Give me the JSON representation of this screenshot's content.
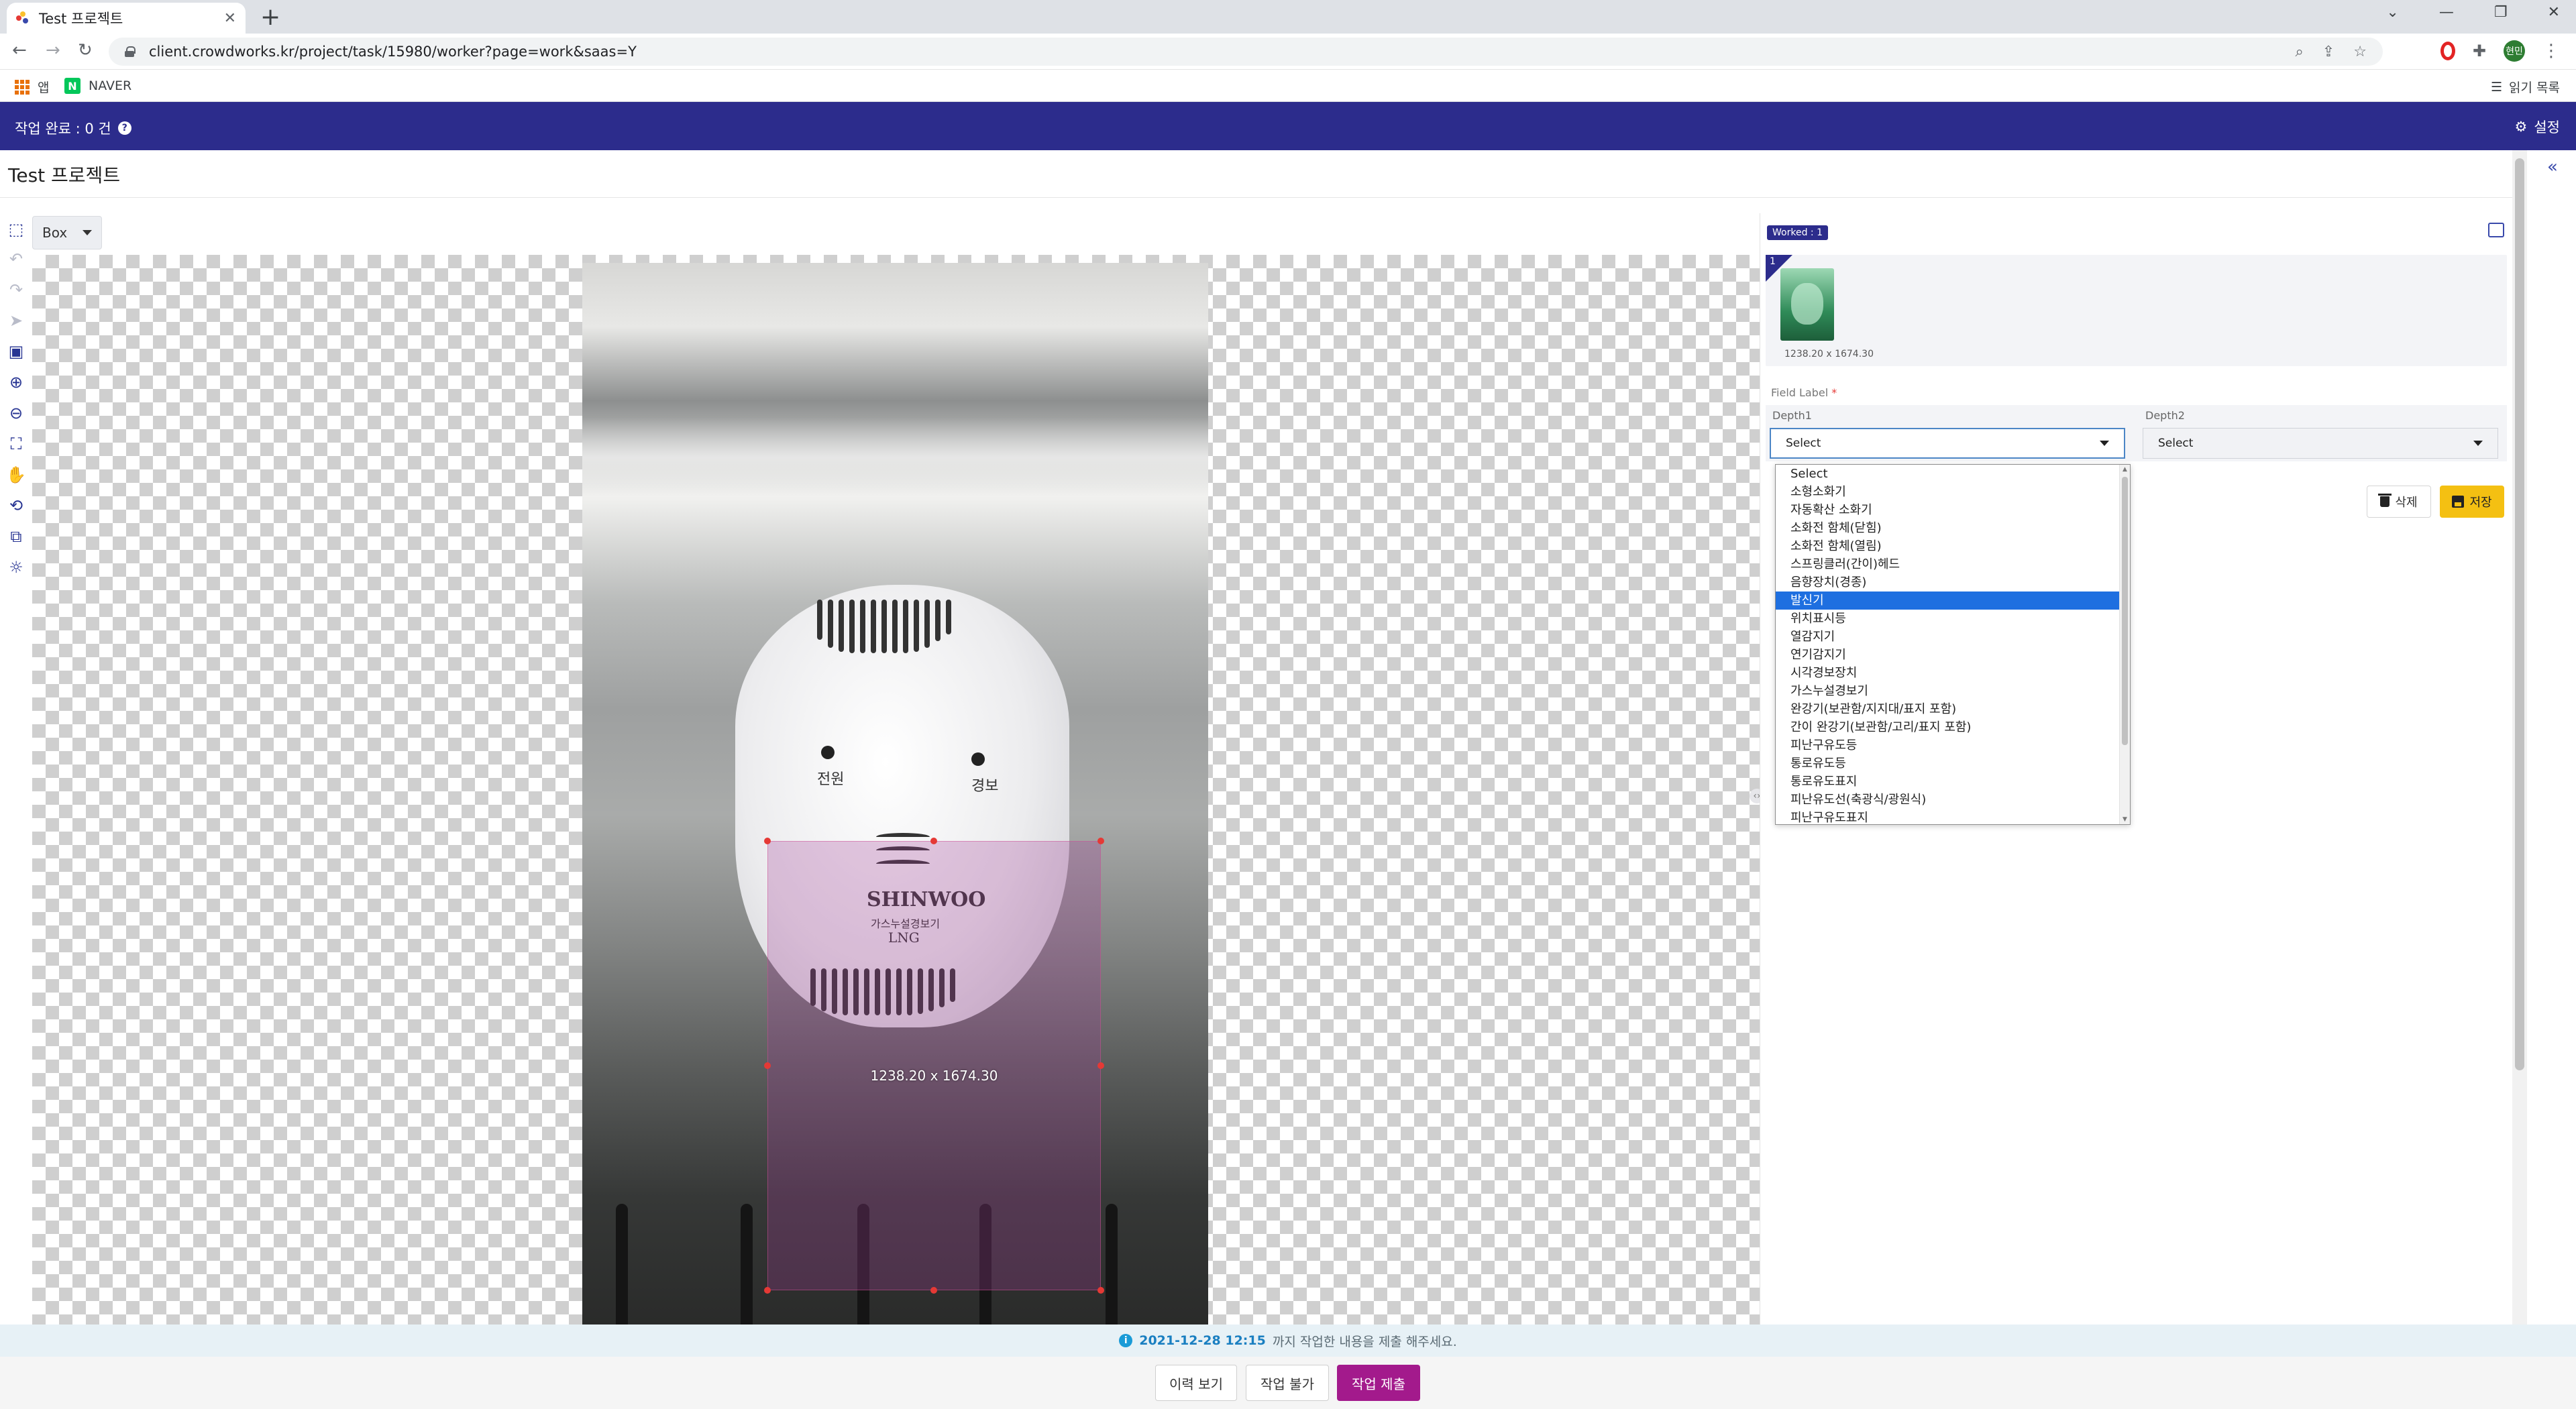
{
  "browser": {
    "tab_title": "Test 프로젝트",
    "tab_close": "✕",
    "new_tab": "+",
    "url": "client.crowdworks.kr/project/task/15980/worker?page=work&saas=Y",
    "profile_initials": "현민",
    "bookmarks": [
      {
        "label": "앱",
        "icon": "apps-grid-icon"
      },
      {
        "label": "NAVER",
        "icon": "naver-logo"
      }
    ],
    "reading_list": "읽기 목록"
  },
  "appbar": {
    "done_label": "작업 완료 : 0 건",
    "help": "?",
    "settings": "설정"
  },
  "project_title": "Test 프로젝트",
  "toolbar": {
    "tool_mode": "Box",
    "tools": [
      "select-box-icon",
      "undo-icon",
      "redo-icon",
      "pointer-icon",
      "image-icon",
      "zoom-in-icon",
      "zoom-out-icon",
      "fit-icon",
      "hand-icon",
      "rotate-icon",
      "layers-icon",
      "brightness-icon"
    ]
  },
  "canvas": {
    "bbox_label": "1238.20 x 1674.30",
    "device_text": {
      "power": "전원",
      "alarm": "경보",
      "brand": "SHINWOO",
      "subtitle": "가스누설경보기",
      "type": "LNG"
    }
  },
  "panel": {
    "worked_badge": "Worked : 1",
    "item_number": "1",
    "thumb_dims": "1238.20 x 1674.30",
    "field_label": "Field Label",
    "required_mark": "*",
    "depth1_label": "Depth1",
    "depth2_label": "Depth2",
    "depth1_value": "Select",
    "depth2_value": "Select",
    "delete_label": "삭제",
    "save_label": "저장"
  },
  "dropdown": {
    "options": [
      "Select",
      "소형소화기",
      "자동확산 소화기",
      "소화전 함체(닫힘)",
      "소화전 함체(열림)",
      "스프링클러(간이)헤드",
      "음향장치(경종)",
      "발신기",
      "위치표시등",
      "열감지기",
      "연기감지기",
      "시각경보장치",
      "가스누설경보기",
      "완강기(보관함/지지대/표지 포함)",
      "간이 완강기(보관함/고리/표지 포함)",
      "피난구유도등",
      "통로유도등",
      "통로유도표지",
      "피난유도선(축광식/광원식)",
      "피난구유도표지"
    ],
    "highlighted": "발신기"
  },
  "footer": {
    "deadline_date": "2021-12-28 12:15",
    "deadline_text": "까지 작업한 내용을 제출 해주세요.",
    "history_button": "이력 보기",
    "unable_button": "작업 불가",
    "submit_button": "작업 제출"
  },
  "colors": {
    "brand_navy": "#2c2c8c",
    "submit_magenta": "#a31a8c",
    "save_yellow": "#f4c012",
    "selected_option": "#1e6fe0"
  }
}
